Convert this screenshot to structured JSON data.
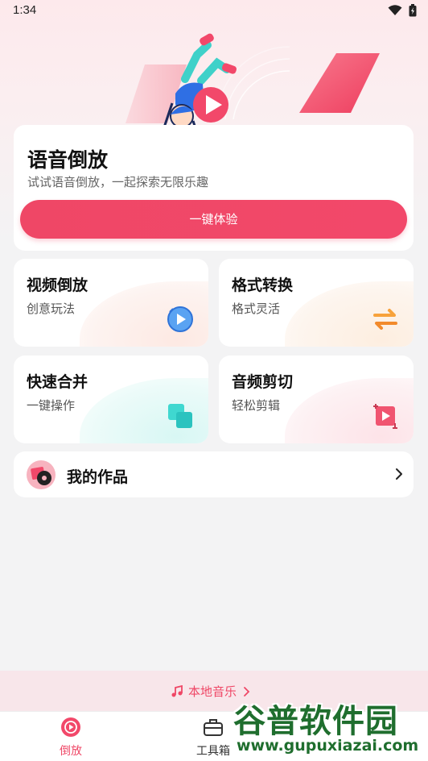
{
  "status_bar": {
    "time": "1:34"
  },
  "main_card": {
    "title": "语音倒放",
    "subtitle": "试试语音倒放，一起探索无限乐趣",
    "button_label": "一键体验"
  },
  "features": [
    {
      "title": "视频倒放",
      "subtitle": "创意玩法",
      "icon": "rewind-play-icon"
    },
    {
      "title": "格式转换",
      "subtitle": "格式灵活",
      "icon": "swap-arrows-icon"
    },
    {
      "title": "快速合并",
      "subtitle": "一键操作",
      "icon": "merge-squares-icon"
    },
    {
      "title": "音频剪切",
      "subtitle": "轻松剪辑",
      "icon": "crop-play-icon"
    }
  ],
  "works": {
    "title": "我的作品"
  },
  "local_music": {
    "label": "本地音乐"
  },
  "tabs": [
    {
      "label": "倒放",
      "icon": "play-circle-icon",
      "active": true
    },
    {
      "label": "工具箱",
      "icon": "toolbox-icon",
      "active": false
    }
  ],
  "watermark": {
    "title": "谷普软件园",
    "url": "www.gupuxiazai.com"
  },
  "colors": {
    "accent": "#ef4766",
    "background": "#f3f3f4",
    "card": "#ffffff"
  }
}
